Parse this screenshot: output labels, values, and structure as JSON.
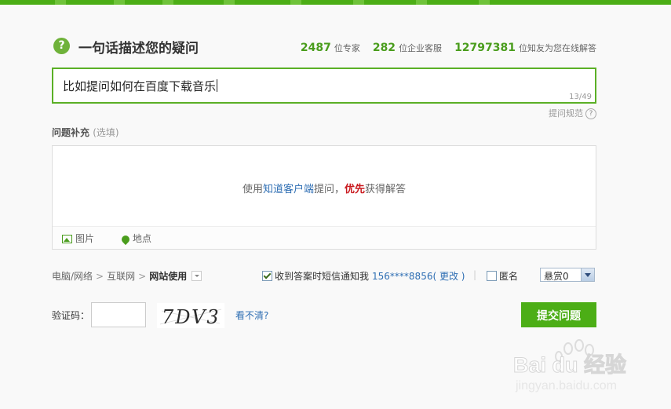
{
  "header": {
    "help_icon_glyph": "?",
    "title": "一句话描述您的疑问",
    "stats": [
      {
        "num": "2487",
        "unit": "位专家"
      },
      {
        "num": "282",
        "unit": "位企业客服"
      },
      {
        "num": "12797381",
        "unit": "位知友为您在线解答"
      }
    ]
  },
  "question": {
    "title_value": "比如提问如何在百度下载音乐",
    "char_counter": "13/49"
  },
  "rules_link": "提问规范",
  "supplement": {
    "label": "问题补充",
    "optional": "(选填)",
    "prompt_prefix": "使用",
    "prompt_link": "知道客户端",
    "prompt_middle": "提问，",
    "prompt_priority": "优先",
    "prompt_suffix": "获得解答",
    "tool_image": "图片",
    "tool_location": "地点"
  },
  "category": {
    "crumbs": [
      "电脑/网络",
      "互联网",
      "网站使用"
    ]
  },
  "sms": {
    "label": "收到答案时短信通知我",
    "phone": "156****8856",
    "change": "( 更改 )"
  },
  "divider": "|",
  "anonymous": {
    "label": "匿名"
  },
  "reward": {
    "value": "悬赏0"
  },
  "captcha": {
    "label": "验证码：",
    "image_text": "7DV3",
    "refresh": "看不清?"
  },
  "submit_label": "提交问题",
  "watermark": {
    "logo": "Bai du 经验",
    "url": "jingyan.baidu.com"
  },
  "colors": {
    "accent_green": "#4cae16",
    "link_blue": "#2e6eb3",
    "priority_red": "#c9191e"
  }
}
